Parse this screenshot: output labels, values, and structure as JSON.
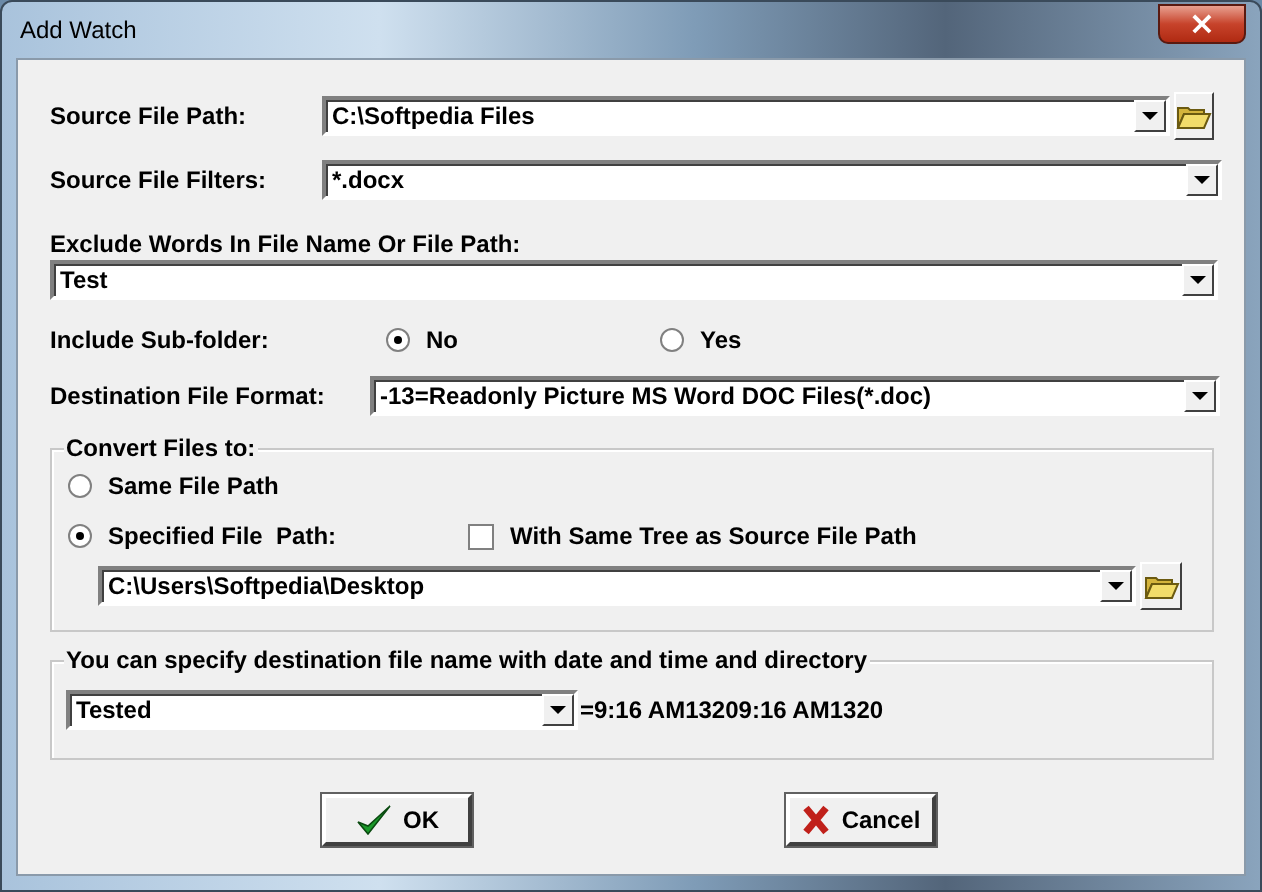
{
  "window": {
    "title": "Add Watch",
    "close": "×"
  },
  "source_path": {
    "label": "Source File Path:",
    "value": "C:\\Softpedia Files"
  },
  "source_filters": {
    "label": "Source File Filters:",
    "value": "*.docx"
  },
  "exclude": {
    "label": "Exclude Words In File Name Or File Path:",
    "value": "Test"
  },
  "include_subfolder": {
    "label": "Include Sub-folder:",
    "options": [
      {
        "label": "No",
        "selected": true
      },
      {
        "label": "Yes",
        "selected": false
      }
    ]
  },
  "destination_format": {
    "label": "Destination File Format:",
    "value": "-13=Readonly Picture MS Word DOC Files(*.doc)"
  },
  "convert_group": {
    "title": "Convert Files to:",
    "options": [
      {
        "label": "Same File Path",
        "selected": false
      },
      {
        "label": "Specified File  Path:",
        "selected": true
      }
    ],
    "same_tree": {
      "label": "With Same Tree as Source File Path",
      "checked": false
    },
    "path": "C:\\Users\\Softpedia\\Desktop"
  },
  "name_group": {
    "title": "You can specify destination file name with date and time and directory",
    "value": "Tested",
    "preview": "=9:16 AM13209:16 AM1320"
  },
  "buttons": [
    {
      "label": "OK",
      "kind": "ok"
    },
    {
      "label": "Cancel",
      "kind": "cancel"
    }
  ]
}
